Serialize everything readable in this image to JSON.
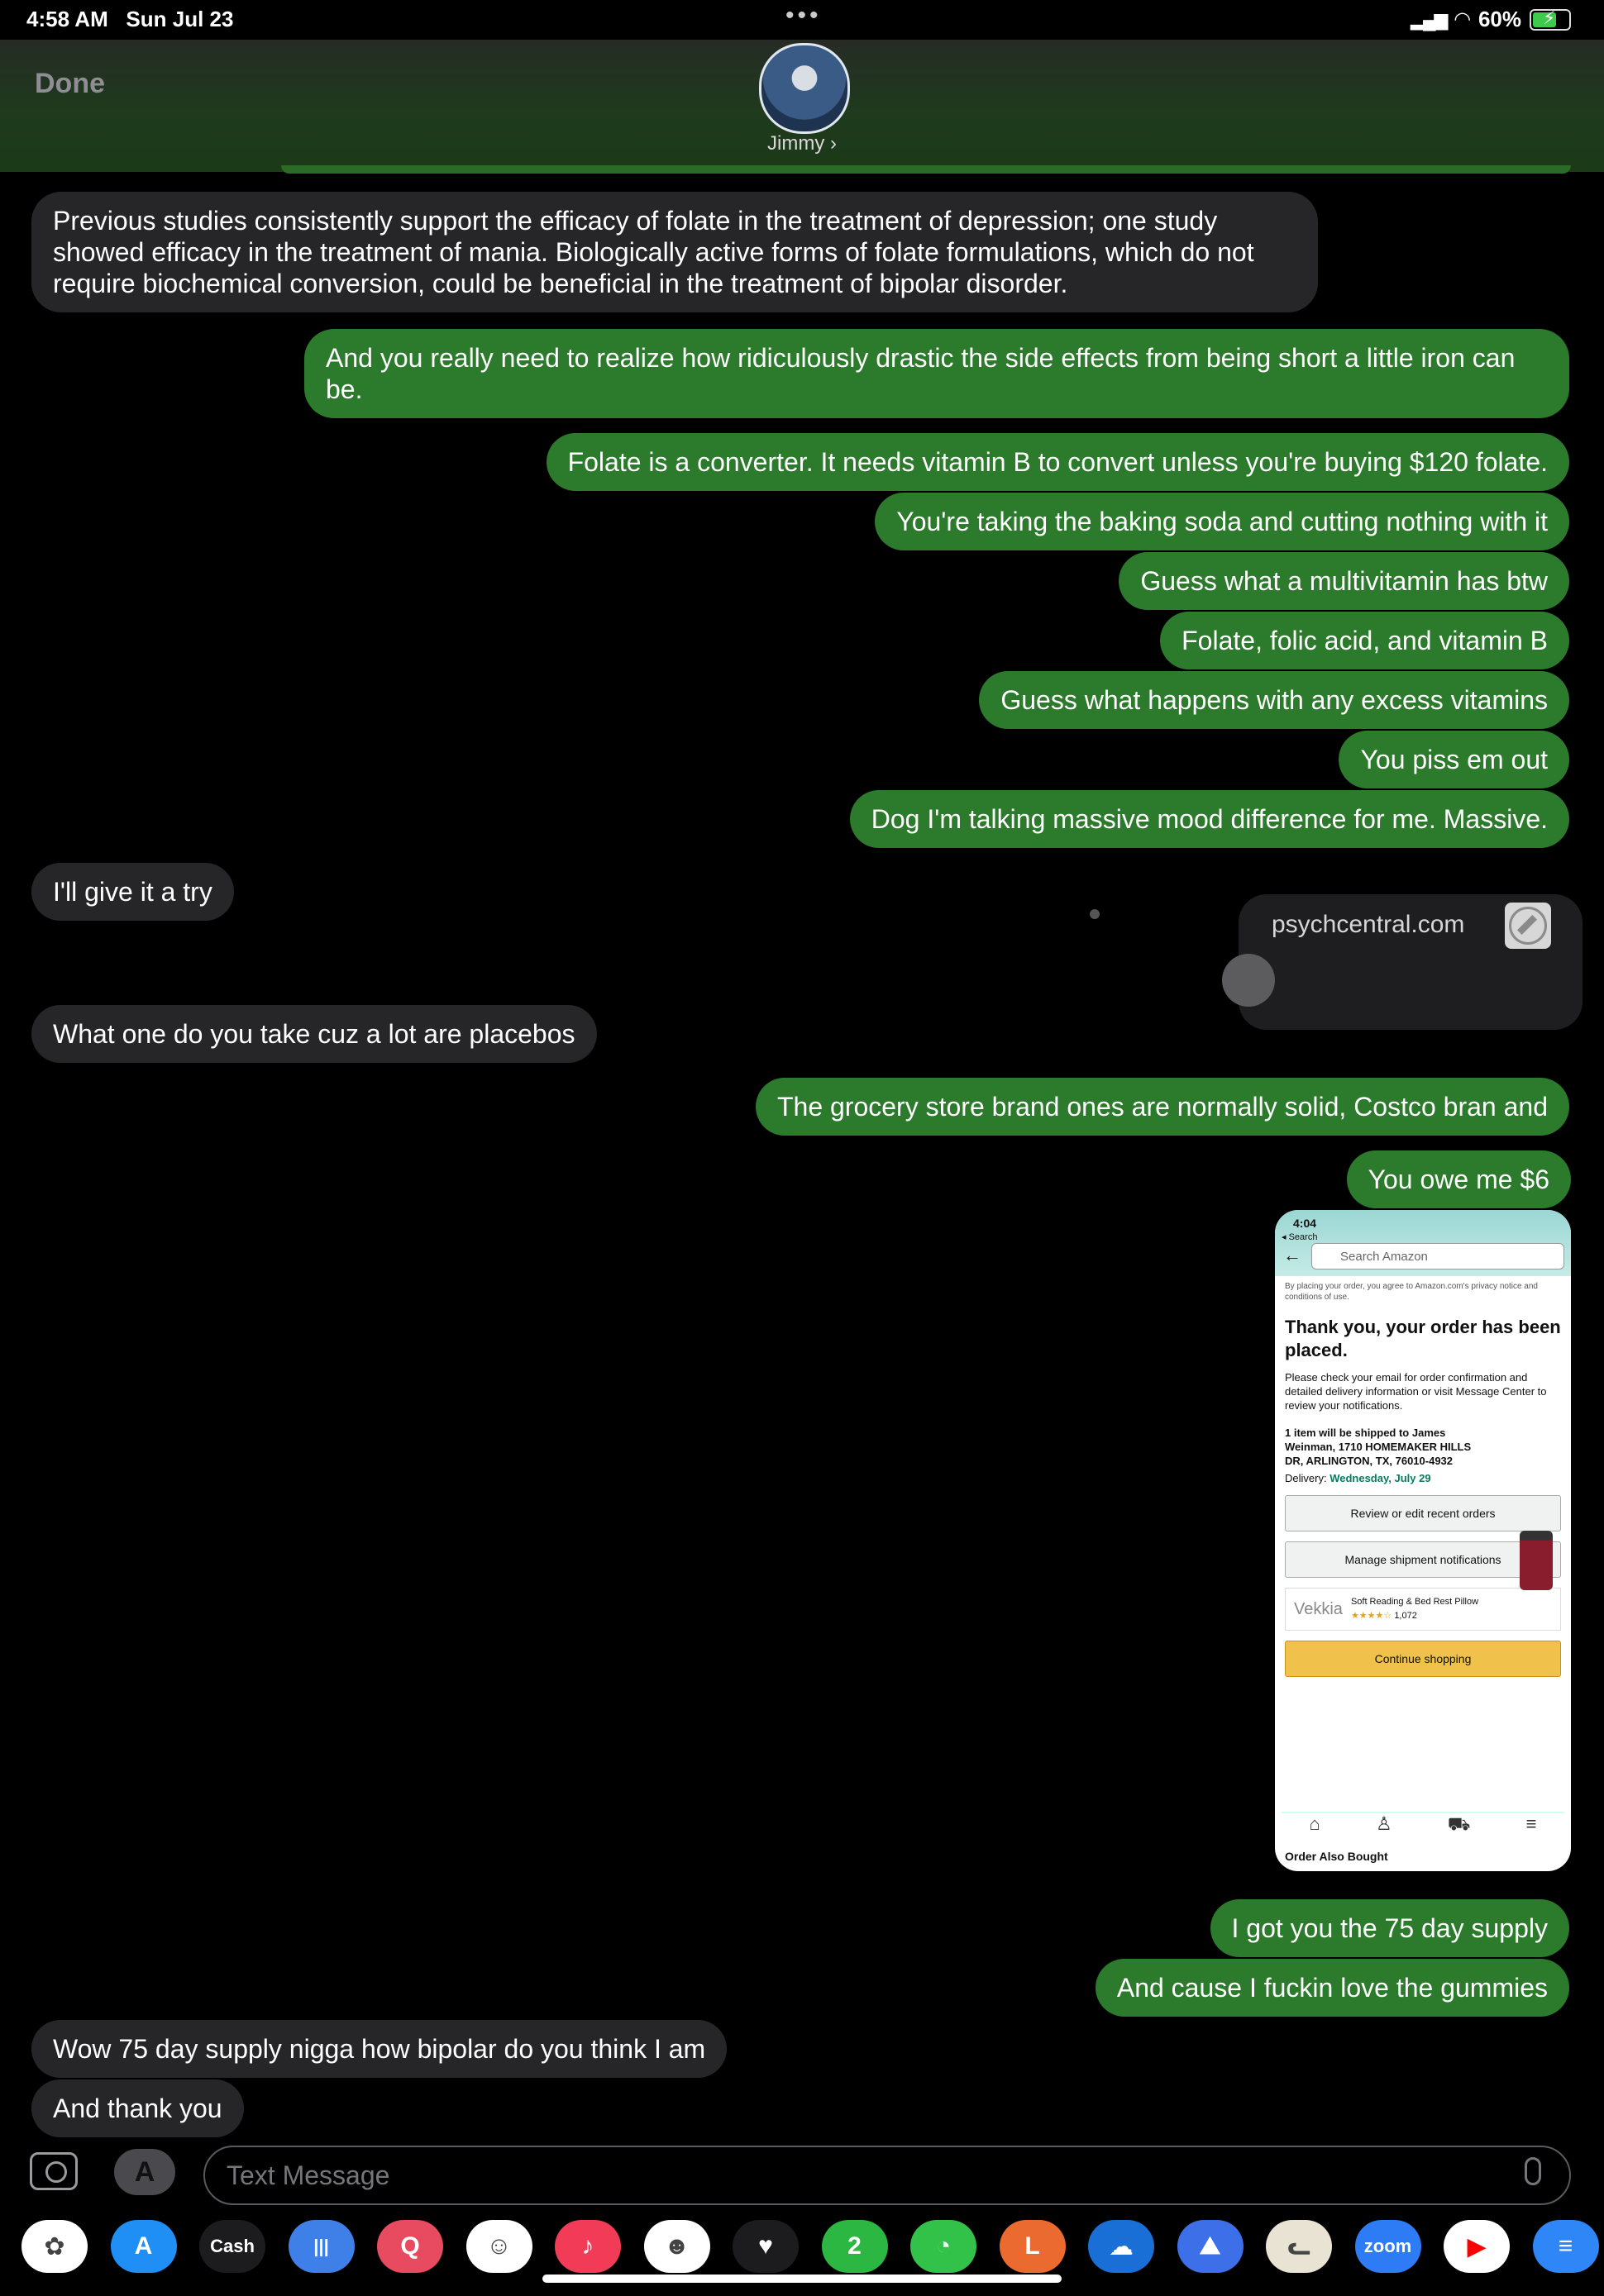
{
  "status_bar": {
    "time": "4:58 AM",
    "date": "Sun Jul 23",
    "battery": "60%"
  },
  "header": {
    "done_label": "Done",
    "contact_name": "Jimmy"
  },
  "messages": [
    {
      "dir": "in",
      "text": "Previous studies consistently support the efficacy of folate in the treatment of depression; one study showed efficacy in the treatment of mania. Biologically active forms of folate formulations, which do not require biochemical conversion, could be beneficial in the treatment of bipolar disorder."
    },
    {
      "dir": "out",
      "text": "And you really need to realize how ridiculously drastic the side effects from being short a little iron can be."
    },
    {
      "dir": "out",
      "text": "Folate is a converter. It needs vitamin B to convert unless you're buying $120 folate."
    },
    {
      "dir": "out",
      "text": "You're taking the baking soda and cutting nothing with it"
    },
    {
      "dir": "out",
      "text": "Guess what a multivitamin has btw"
    },
    {
      "dir": "out",
      "text": "Folate, folic acid, and vitamin B"
    },
    {
      "dir": "out",
      "text": "Guess what happens with any excess vitamins"
    },
    {
      "dir": "out",
      "text": "You piss em out"
    },
    {
      "dir": "out",
      "text": "Dog I'm talking massive mood difference for me. Massive."
    },
    {
      "dir": "in",
      "text": "I'll give it a try"
    },
    {
      "dir": "in",
      "text": "What one do you take cuz a lot are placebos"
    },
    {
      "dir": "out",
      "text": "The grocery store brand ones are normally solid, Costco bran and"
    },
    {
      "dir": "out",
      "text": "You owe me $6"
    },
    {
      "dir": "out",
      "text": "I got you the 75 day supply"
    },
    {
      "dir": "out",
      "text": "And cause I fuckin love the gummies"
    },
    {
      "dir": "in",
      "text": "Wow 75 day supply nigga how bipolar do you think I am"
    },
    {
      "dir": "in",
      "text": "And thank you"
    }
  ],
  "link_preview": {
    "domain": "psychcentral.com"
  },
  "screenshot": {
    "time": "4:04",
    "back": "◂ Search",
    "search_placeholder": "Search Amazon",
    "fine_print": "By placing your order, you agree to Amazon.com's privacy notice and conditions of use.",
    "title": "Thank you, your order has been placed.",
    "info": "Please check your email for order confirmation and detailed delivery information or visit Message Center to review your notifications.",
    "ship_to": "1 item will be shipped to James Weinman, 1710 HOMEMAKER HILLS DR, ARLINGTON, TX, 76010-4932",
    "delivery_label": "Delivery:",
    "delivery_date": "Wednesday, July 29",
    "btn_review": "Review or edit recent orders",
    "btn_manage": "Manage shipment notifications",
    "ad_brand": "Vekkia",
    "ad_text": "Soft Reading & Bed Rest Pillow",
    "ad_count": "1,072",
    "btn_continue": "Continue shopping",
    "footer": "Order Also Bought"
  },
  "composer": {
    "placeholder": "Text Message"
  },
  "dock": [
    {
      "name": "photos",
      "label": "✿",
      "color": "#ffffff"
    },
    {
      "name": "app-store",
      "label": "A",
      "color": "#1f8ef5"
    },
    {
      "name": "apple-cash",
      "label": "Cash",
      "color": "#1c1c1e"
    },
    {
      "name": "audio",
      "label": "|||",
      "color": "#3f7fe8"
    },
    {
      "name": "search-app",
      "label": "Q",
      "color": "#e84a5f"
    },
    {
      "name": "memoji",
      "label": "☺",
      "color": "#ffffff"
    },
    {
      "name": "music",
      "label": "♪",
      "color": "#f23b57"
    },
    {
      "name": "memoji-2",
      "label": "☻",
      "color": "#ffffff"
    },
    {
      "name": "fitness",
      "label": "♥",
      "color": "#1c1c1e"
    },
    {
      "name": "whatsapp",
      "label": "2",
      "color": "#2bb741"
    },
    {
      "name": "clock",
      "label": "◔",
      "color": "#32c24a"
    },
    {
      "name": "office",
      "label": "L",
      "color": "#eb6a2f"
    },
    {
      "name": "onedrive",
      "label": "☁",
      "color": "#1a6fd6"
    },
    {
      "name": "nord",
      "label": "⛰",
      "color": "#3c6fe8"
    },
    {
      "name": "cat",
      "label": "ᓚ",
      "color": "#e9e3d4"
    },
    {
      "name": "zoom",
      "label": "zoom",
      "color": "#2d7cf6"
    },
    {
      "name": "youtube",
      "label": "▶",
      "color": "#ffffff"
    },
    {
      "name": "list",
      "label": "≡",
      "color": "#2f86f6"
    }
  ]
}
